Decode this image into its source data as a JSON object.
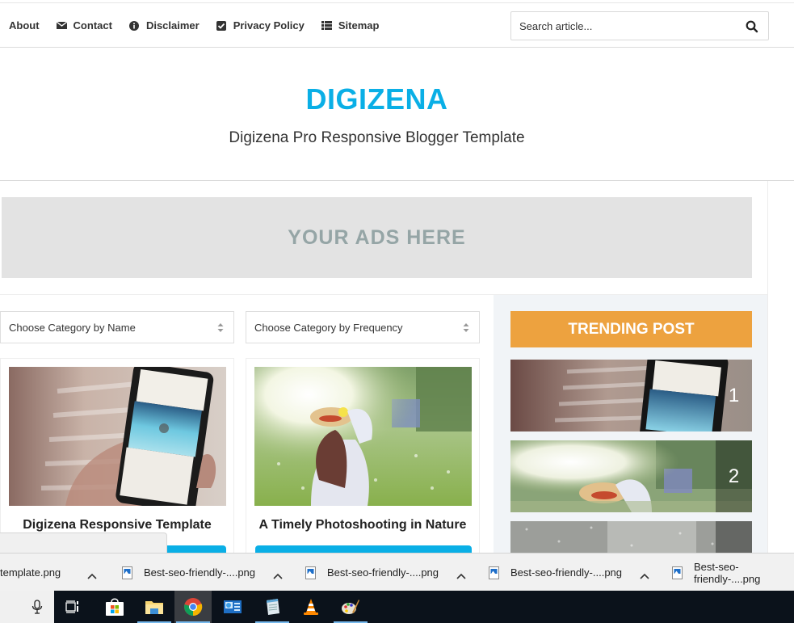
{
  "nav": {
    "items": [
      {
        "label": "About",
        "icon": "user-icon"
      },
      {
        "label": "Contact",
        "icon": "envelope-icon"
      },
      {
        "label": "Disclaimer",
        "icon": "info-circle-icon"
      },
      {
        "label": "Privacy Policy",
        "icon": "check-square-icon"
      },
      {
        "label": "Sitemap",
        "icon": "list-icon"
      }
    ],
    "search_placeholder": "Search article..."
  },
  "header": {
    "logo": "DIGIZENA",
    "tagline": "Digizena Pro Responsive Blogger Template"
  },
  "ad": {
    "text": "YOUR ADS HERE"
  },
  "filters": {
    "by_name": "Choose Category by Name",
    "by_frequency": "Choose Category by Frequency"
  },
  "posts": [
    {
      "title": "Digizena Responsive Template",
      "image": "hand-holding-phone-photo"
    },
    {
      "title": "A Timely Photoshooting in Nature",
      "image": "girl-in-meadow-photo"
    }
  ],
  "trending": {
    "heading": "TRENDING POST",
    "items": [
      {
        "rank": "1",
        "image": "hand-holding-phone-photo"
      },
      {
        "rank": "2",
        "image": "girl-in-meadow-photo"
      },
      {
        "rank": "",
        "image": "snowy-forest-photo"
      }
    ]
  },
  "downloads": [
    {
      "name": "template.png"
    },
    {
      "name": "Best-seo-friendly-....png"
    },
    {
      "name": "Best-seo-friendly-....png"
    },
    {
      "name": "Best-seo-friendly-....png"
    },
    {
      "name": "Best-seo-friendly-....png"
    }
  ],
  "taskbar": {
    "items": [
      "microphone-icon",
      "task-view-icon",
      "store-icon",
      "file-explorer-icon",
      "chrome-icon",
      "control-panel-icon",
      "notepad-icon",
      "vlc-icon",
      "paint-icon"
    ]
  },
  "colors": {
    "brand": "#0aafe6",
    "trending_header": "#eda23f",
    "ad_text": "#95a5a6"
  }
}
